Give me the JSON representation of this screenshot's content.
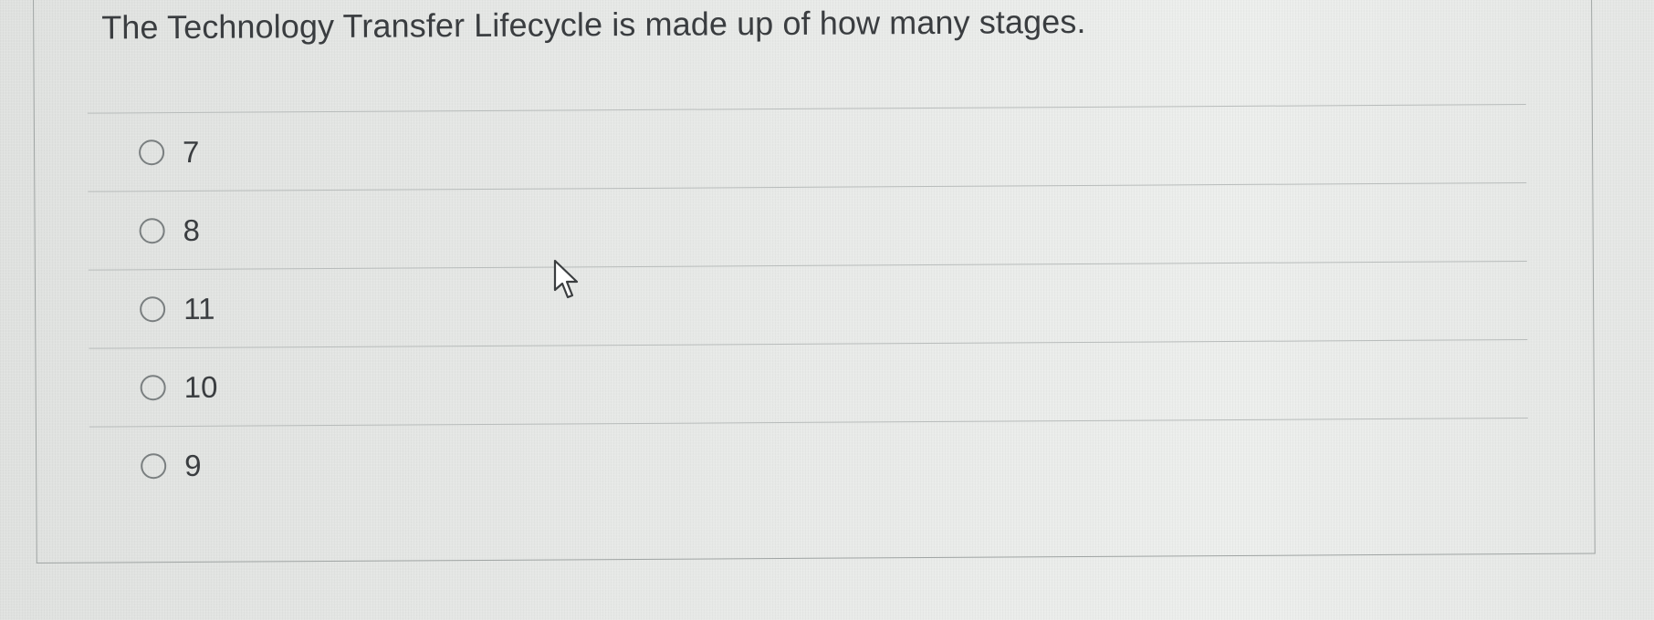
{
  "question": {
    "text": "The Technology Transfer Lifecycle is made up of how many stages."
  },
  "options": [
    {
      "label": "7",
      "selected": false
    },
    {
      "label": "8",
      "selected": false
    },
    {
      "label": "11",
      "selected": false
    },
    {
      "label": "10",
      "selected": false
    },
    {
      "label": "9",
      "selected": false
    }
  ],
  "cursor": {
    "icon": "arrow-pointer-icon"
  }
}
